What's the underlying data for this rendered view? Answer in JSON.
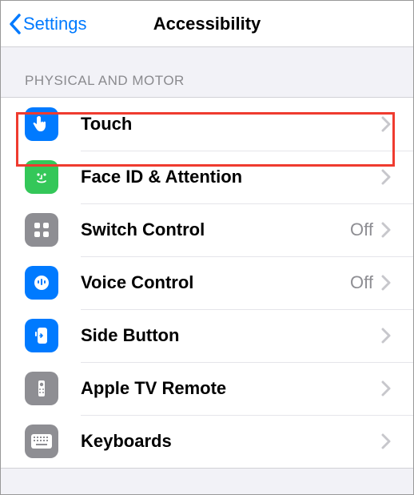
{
  "nav": {
    "back_label": "Settings",
    "title": "Accessibility"
  },
  "section": {
    "header": "PHYSICAL AND MOTOR",
    "items": [
      {
        "label": "Touch",
        "value": "",
        "icon": "hand-tap",
        "bg": "bg-blue",
        "highlighted": true
      },
      {
        "label": "Face ID & Attention",
        "value": "",
        "icon": "face",
        "bg": "bg-green"
      },
      {
        "label": "Switch Control",
        "value": "Off",
        "icon": "grid",
        "bg": "bg-grey"
      },
      {
        "label": "Voice Control",
        "value": "Off",
        "icon": "voice",
        "bg": "bg-blue"
      },
      {
        "label": "Side Button",
        "value": "",
        "icon": "side-button",
        "bg": "bg-blue"
      },
      {
        "label": "Apple TV Remote",
        "value": "",
        "icon": "remote",
        "bg": "bg-grey"
      },
      {
        "label": "Keyboards",
        "value": "",
        "icon": "keyboard",
        "bg": "bg-grey"
      }
    ]
  },
  "colors": {
    "accent": "#007aff",
    "highlight_border": "#ef3b2f"
  }
}
